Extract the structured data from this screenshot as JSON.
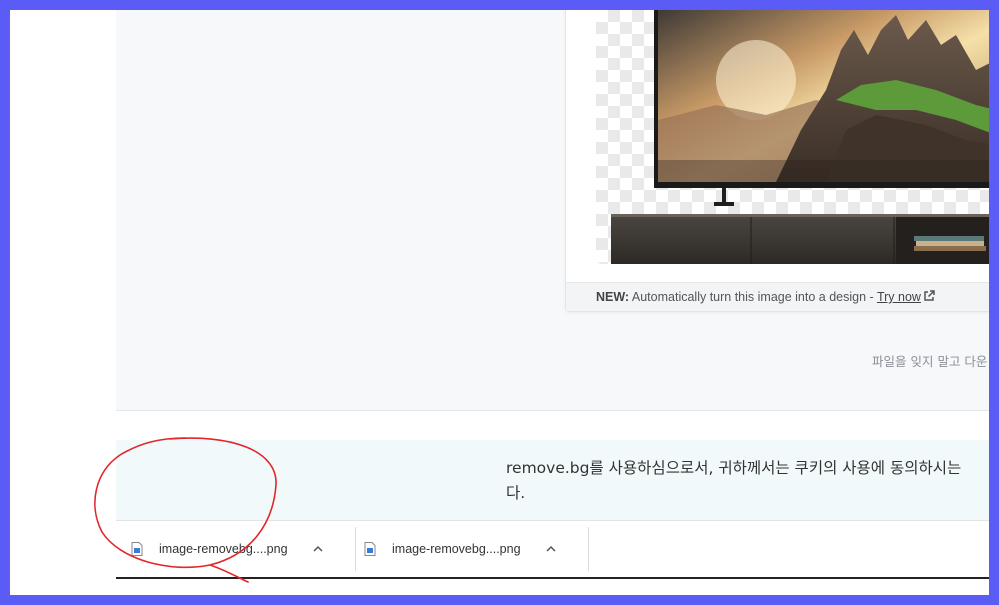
{
  "card": {
    "footer_new": "NEW:",
    "footer_text": " Automatically turn this image into a design - ",
    "footer_link": "Try now"
  },
  "page_note": "파일을 잊지 말고 다운",
  "cookie": {
    "line1": "remove.bg를 사용하심으로서, 귀하께서는 쿠키의 사용에 동의하시는",
    "line2": "다."
  },
  "downloads": [
    {
      "name": "image-removebg....png"
    },
    {
      "name": "image-removebg....png"
    }
  ],
  "colors": {
    "frame": "#5a5cf5",
    "annotation": "#e3262a",
    "cookie_bg": "#f1f9fb"
  },
  "icons": [
    "external-link-icon",
    "png-file-icon",
    "chevron-up-icon"
  ]
}
